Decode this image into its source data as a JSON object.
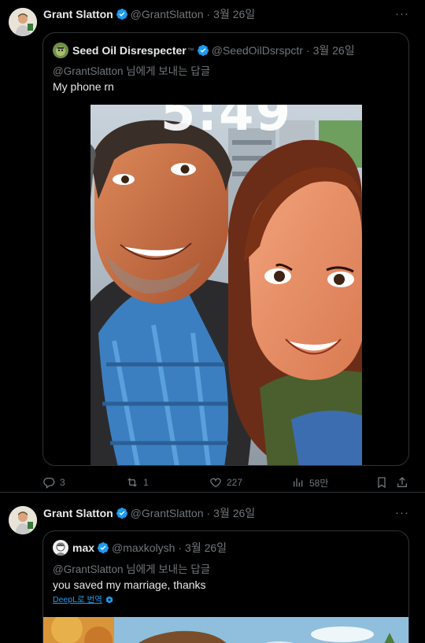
{
  "tweets": [
    {
      "author_name": "Grant Slatton",
      "author_handle": "@GrantSlatton",
      "date": "3월 26일",
      "quote": {
        "author_name": "Seed Oil Disrespecter",
        "author_suffix": "™",
        "author_handle": "@SeedOilDsrspctr",
        "date": "3월 26일",
        "reply_to": "@GrantSlatton 님에게 보내는 답글",
        "text": "My phone rn",
        "image_time_text": "5:49"
      },
      "actions": {
        "replies": "3",
        "retweets": "1",
        "likes": "227",
        "views": "58만"
      }
    },
    {
      "author_name": "Grant Slatton",
      "author_handle": "@GrantSlatton",
      "date": "3월 26일",
      "quote": {
        "author_name": "max",
        "author_handle": "@maxkolysh",
        "date": "3월 26일",
        "reply_to": "@GrantSlatton 님에게 보내는 답글",
        "text": "you saved my marriage, thanks",
        "translate_label": "DeepL로 번역"
      }
    }
  ],
  "icons": {
    "verified": "verified-badge-icon",
    "more": "more-dots-icon",
    "reply": "reply-icon",
    "retweet": "retweet-icon",
    "like": "heart-icon",
    "views": "views-icon",
    "bookmark": "bookmark-icon",
    "share": "share-icon"
  },
  "colors": {
    "background": "#000000",
    "text": "#e7e9ea",
    "muted": "#71767b",
    "border": "#2f3336",
    "verified": "#1d9bf0"
  }
}
